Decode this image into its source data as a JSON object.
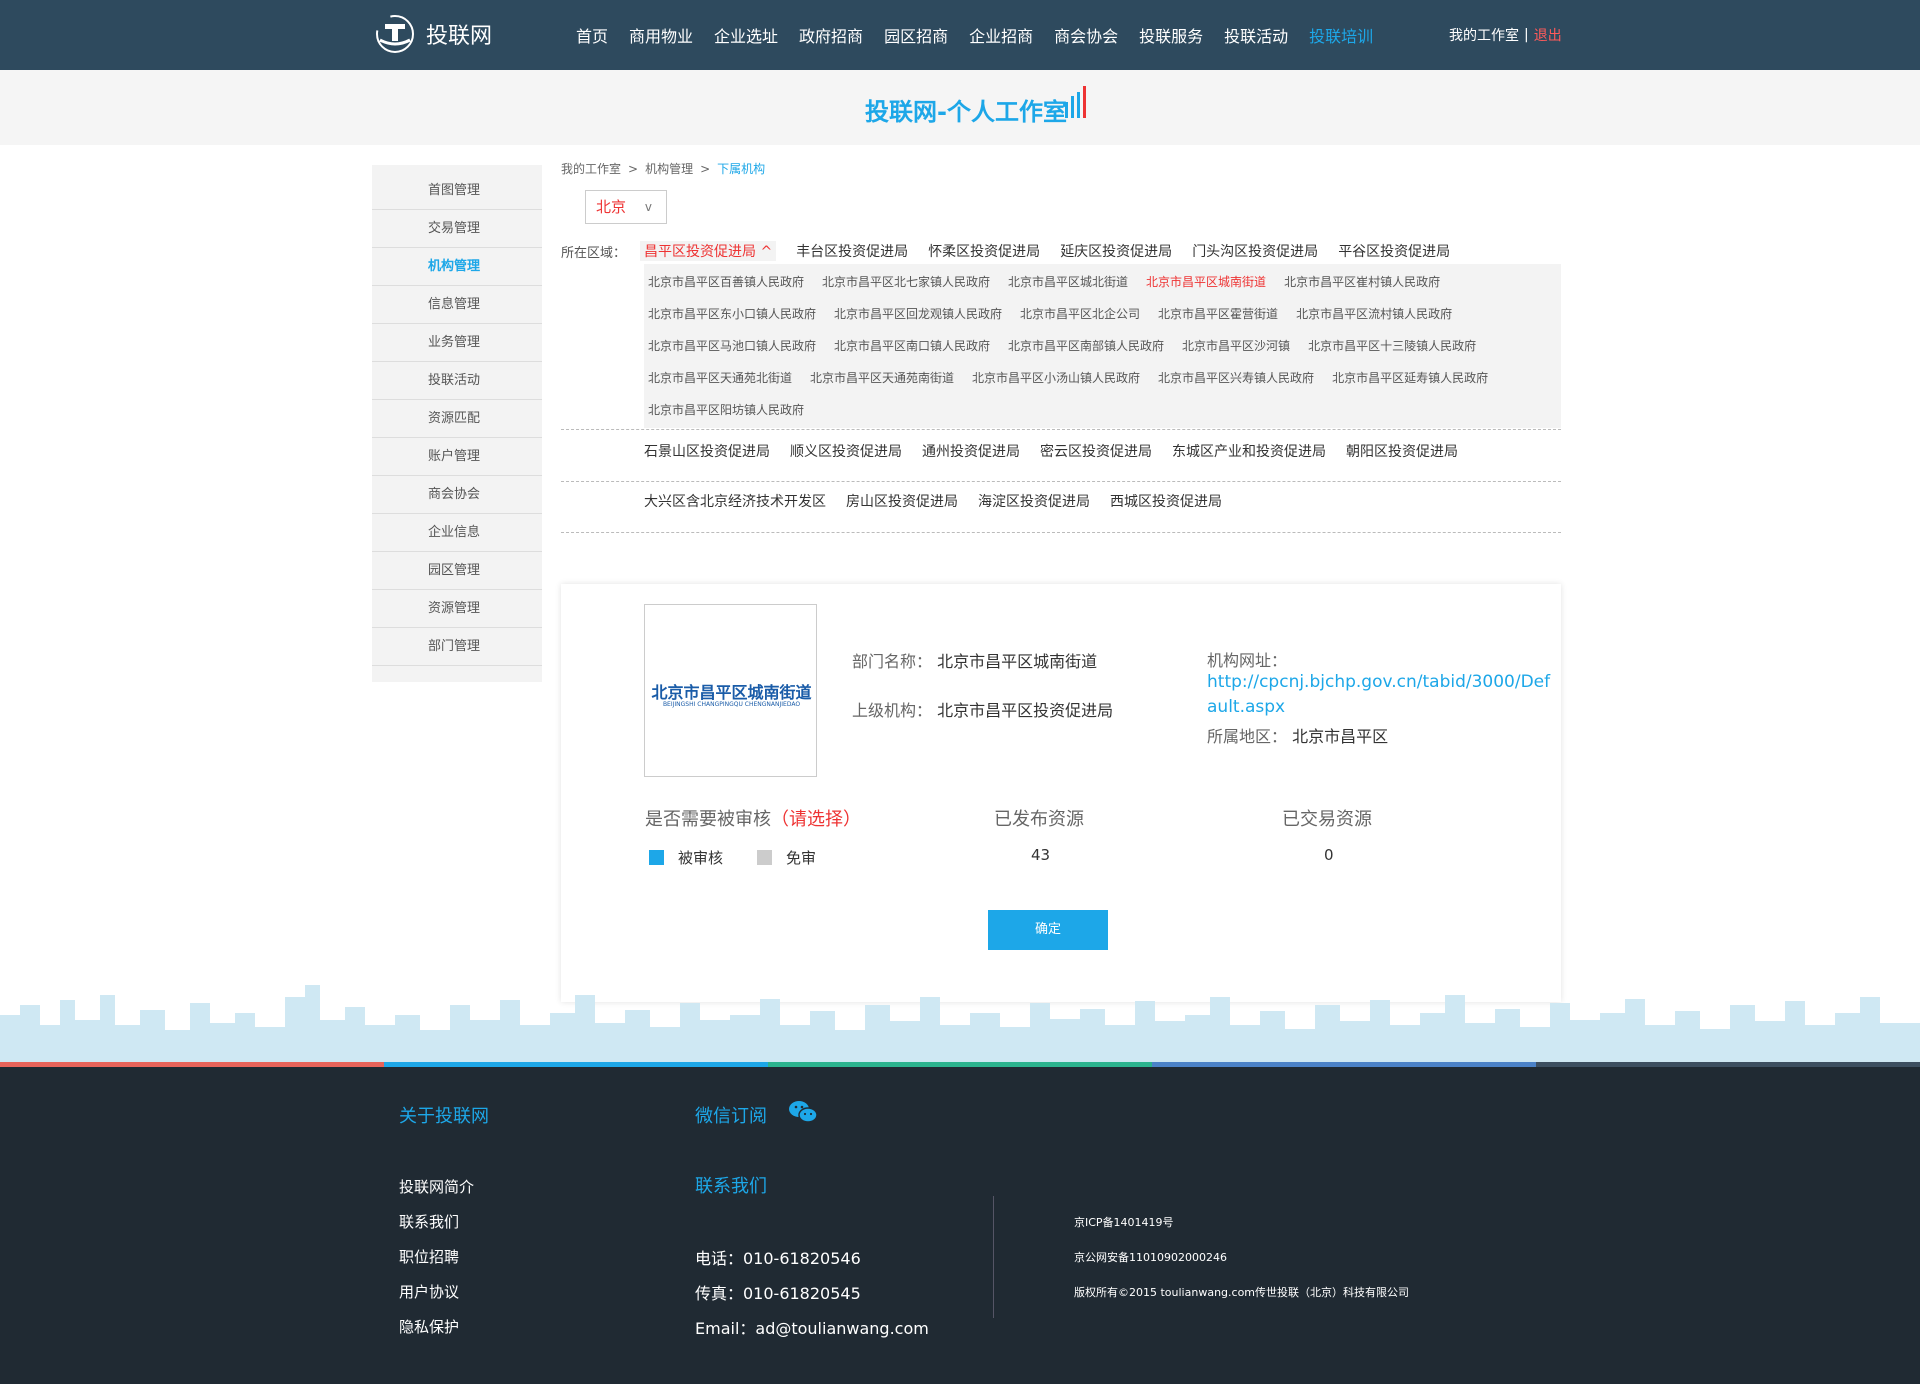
{
  "brand": {
    "name": "投联网"
  },
  "nav": [
    "首页",
    "商用物业",
    "企业选址",
    "政府招商",
    "园区招商",
    "企业招商",
    "商会协会",
    "投联服务",
    "投联活动",
    "投联培训"
  ],
  "user": {
    "studio": "我的工作室",
    "sep": "|",
    "logout": "退出"
  },
  "page_heading": "投联网-个人工作室",
  "sidebar": [
    "首图管理",
    "交易管理",
    "机构管理",
    "信息管理",
    "业务管理",
    "投联活动",
    "资源匹配",
    "账户管理",
    "商会协会",
    "企业信息",
    "园区管理",
    "资源管理",
    "部门管理"
  ],
  "breadcrumb": [
    "我的工作室",
    "机构管理",
    "下属机构"
  ],
  "breadcrumb_sep": ">",
  "city": {
    "value": "北京",
    "chevron": "v"
  },
  "region_label": "所在区域：",
  "regions_row1": [
    "昌平区投资促进局 ^",
    "丰台区投资促进局",
    "怀柔区投资促进局",
    "延庆区投资促进局",
    "门头沟区投资促进局",
    "平谷区投资促进局"
  ],
  "sub_orgs": [
    [
      "北京市昌平区百善镇人民政府",
      "北京市昌平区北七家镇人民政府",
      "北京市昌平区城北街道",
      "北京市昌平区城南街道",
      "北京市昌平区崔村镇人民政府"
    ],
    [
      "北京市昌平区东小口镇人民政府",
      "北京市昌平区回龙观镇人民政府",
      "北京市昌平区北企公司",
      "北京市昌平区霍营街道",
      "北京市昌平区流村镇人民政府"
    ],
    [
      "北京市昌平区马池口镇人民政府",
      "北京市昌平区南口镇人民政府",
      "北京市昌平区南部镇人民政府",
      "北京市昌平区沙河镇",
      "北京市昌平区十三陵镇人民政府"
    ],
    [
      "北京市昌平区天通苑北街道",
      "北京市昌平区天通苑南街道",
      "北京市昌平区小汤山镇人民政府",
      "北京市昌平区兴寿镇人民政府",
      "北京市昌平区延寿镇人民政府"
    ],
    [
      "北京市昌平区阳坊镇人民政府"
    ]
  ],
  "regions_row2": [
    "石景山区投资促进局",
    "顺义区投资促进局",
    "通州投资促进局",
    "密云区投资促进局",
    "东城区产业和投资促进局",
    "朝阳区投资促进局"
  ],
  "regions_row3": [
    "大兴区含北京经济技术开发区",
    "房山区投资促进局",
    "海淀区投资促进局",
    "西城区投资促进局"
  ],
  "org": {
    "logo_text": "北京市昌平区城南街道",
    "logo_sub": "BEIJINGSHI CHANGPINGQU CHENGNANJIEDAO",
    "dept_label": "部门名称：",
    "dept_value": "北京市昌平区城南街道",
    "parent_label": "上级机构：",
    "parent_value": "北京市昌平区投资促进局",
    "url_label": "机构网址：",
    "url_value": "http://cpcnj.bjchp.gov.cn/tabid/3000/Default.aspx",
    "area_label": "所属地区：",
    "area_value": "北京市昌平区"
  },
  "review": {
    "label": "是否需要被审核",
    "hint": "（请选择）",
    "opt1": "被审核",
    "opt2": "免审",
    "opt1_color": "#1da7e8",
    "opt2_color": "#cccccc"
  },
  "published": {
    "label": "已发布资源",
    "value": "43"
  },
  "traded": {
    "label": "已交易资源",
    "value": "0"
  },
  "confirm": "确定",
  "footer": {
    "about_title": "关于投联网",
    "wechat_title": "微信订阅",
    "contact_title": "联系我们",
    "links": [
      "投联网简介",
      "联系我们",
      "职位招聘",
      "用户协议",
      "隐私保护"
    ],
    "phone": "电话：010-61820546",
    "fax": "传真：010-61820545",
    "email": "Email：ad@toulianwang.com",
    "icp": "京ICP备1401419号",
    "police": "京公网安备11010902000246",
    "copyright": "版权所有©2015 toulianwang.com传世投联（北京）科技有限公司"
  },
  "colors": {
    "accent": "#1da7e8",
    "nav_bg": "#2e4a5e",
    "footer_bg": "#202a33",
    "alert": "#e33333"
  }
}
